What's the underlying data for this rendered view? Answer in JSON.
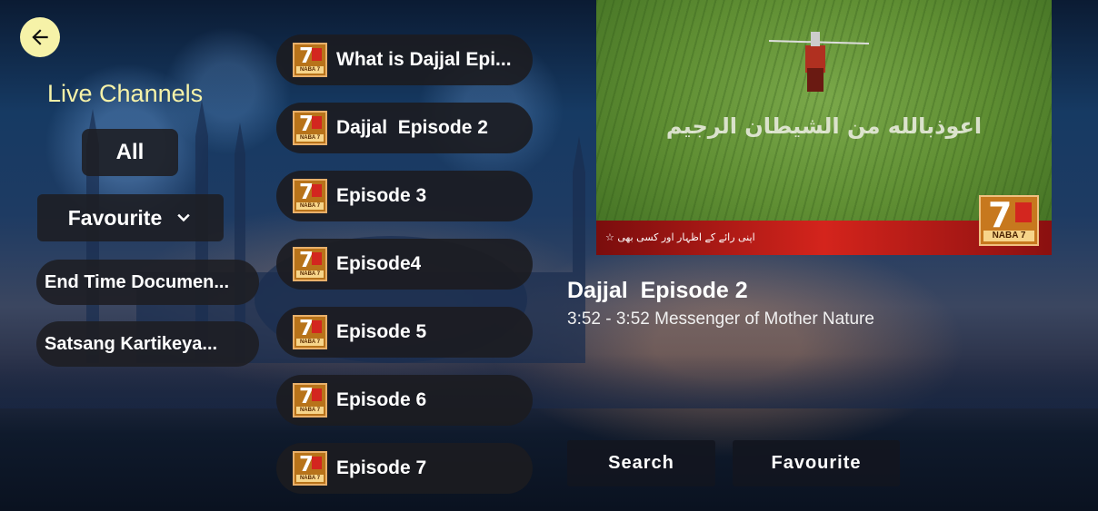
{
  "sidebar": {
    "back_label": "",
    "title": "Live Channels",
    "all_label": "All",
    "favourite_label": "Favourite",
    "categories": [
      {
        "label": "End Time Documen..."
      },
      {
        "label": "Satsang Kartikeya..."
      }
    ]
  },
  "channels": [
    {
      "name": "What is Dajjal Epi..."
    },
    {
      "name": "Dajjal  Episode 2"
    },
    {
      "name": "Episode 3"
    },
    {
      "name": "Episode4"
    },
    {
      "name": "Episode 5"
    },
    {
      "name": "Episode 6"
    },
    {
      "name": "Episode 7"
    }
  ],
  "channel_logo": {
    "seven": "7",
    "tag": "NABA 7"
  },
  "player": {
    "overlay_text": "اعوذبالله من الشيطان الرجيم",
    "ticker_text": "☆ اپنی رائے کے اظہار اور کسی بھی",
    "logo_tag": "NABA 7"
  },
  "now_playing": {
    "title": "Dajjal  Episode 2",
    "subtitle": "3:52 - 3:52 Messenger of Mother Nature"
  },
  "actions": {
    "search_label": "Search",
    "favourite_label": "Favourite"
  },
  "colors": {
    "accent": "#f6f2a8",
    "pill_bg": "#1e1e22"
  }
}
